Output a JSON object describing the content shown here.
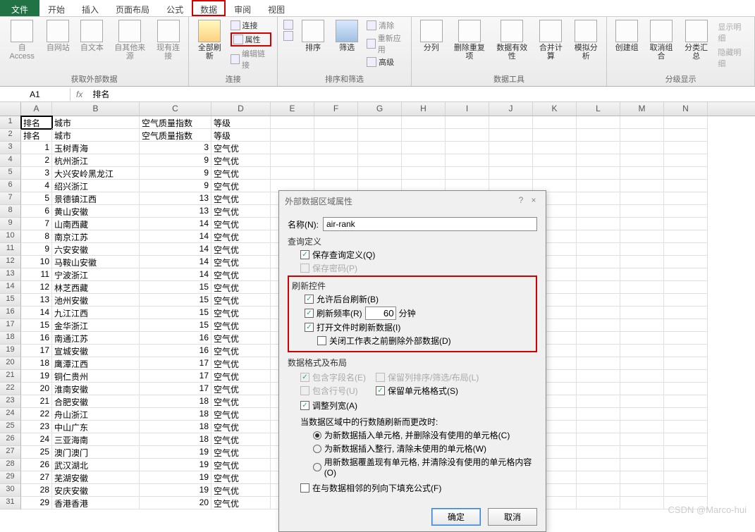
{
  "menu": {
    "file": "文件",
    "start": "开始",
    "insert": "插入",
    "pagelayout": "页面布局",
    "formula": "公式",
    "data": "数据",
    "review": "审阅",
    "view": "视图"
  },
  "ribbon": {
    "ext_data": {
      "access": "自 Access",
      "web": "自网站",
      "text": "自文本",
      "other": "自其他来源",
      "existing": "现有连接",
      "label": "获取外部数据"
    },
    "conn": {
      "refresh": "全部刷新",
      "connect": "连接",
      "props": "属性",
      "editlink": "编辑链接",
      "label": "连接"
    },
    "sort": {
      "az": "A↓Z",
      "za": "Z↓A",
      "sort": "排序",
      "filter": "筛选",
      "clear": "清除",
      "reapply": "重新应用",
      "adv": "高级",
      "label": "排序和筛选"
    },
    "tools": {
      "split": "分列",
      "dedup": "删除重复项",
      "valid": "数据有效性",
      "consol": "合并计算",
      "whatif": "模拟分析",
      "label": "数据工具"
    },
    "outline": {
      "group": "创建组",
      "ungroup": "取消组合",
      "subtotal": "分类汇总",
      "label": "分级显示",
      "show": "显示明细",
      "hide": "隐藏明细"
    }
  },
  "fx": {
    "namebox": "A1",
    "value": "排名"
  },
  "cols": [
    "A",
    "B",
    "C",
    "D",
    "E",
    "F",
    "G",
    "H",
    "I",
    "J",
    "K",
    "L",
    "M",
    "N"
  ],
  "sheet": [
    {
      "a": "排名",
      "b": "城市",
      "c": "空气质量指数",
      "d": "等级"
    },
    {
      "a": "排名",
      "b": "城市",
      "c": "空气质量指数",
      "d": "等级"
    },
    {
      "a": "1",
      "b": "玉树青海",
      "c": "3",
      "d": "空气优"
    },
    {
      "a": "2",
      "b": "杭州浙江",
      "c": "9",
      "d": "空气优"
    },
    {
      "a": "3",
      "b": "大兴安岭黑龙江",
      "c": "9",
      "d": "空气优"
    },
    {
      "a": "4",
      "b": "绍兴浙江",
      "c": "9",
      "d": "空气优"
    },
    {
      "a": "5",
      "b": "景德镇江西",
      "c": "13",
      "d": "空气优"
    },
    {
      "a": "6",
      "b": "黄山安徽",
      "c": "13",
      "d": "空气优"
    },
    {
      "a": "7",
      "b": "山南西藏",
      "c": "14",
      "d": "空气优"
    },
    {
      "a": "8",
      "b": "南京江苏",
      "c": "14",
      "d": "空气优"
    },
    {
      "a": "9",
      "b": "六安安徽",
      "c": "14",
      "d": "空气优"
    },
    {
      "a": "10",
      "b": "马鞍山安徽",
      "c": "14",
      "d": "空气优"
    },
    {
      "a": "11",
      "b": "宁波浙江",
      "c": "14",
      "d": "空气优"
    },
    {
      "a": "12",
      "b": "林芝西藏",
      "c": "15",
      "d": "空气优"
    },
    {
      "a": "13",
      "b": "池州安徽",
      "c": "15",
      "d": "空气优"
    },
    {
      "a": "14",
      "b": "九江江西",
      "c": "15",
      "d": "空气优"
    },
    {
      "a": "15",
      "b": "金华浙江",
      "c": "15",
      "d": "空气优"
    },
    {
      "a": "16",
      "b": "南通江苏",
      "c": "16",
      "d": "空气优"
    },
    {
      "a": "17",
      "b": "宣城安徽",
      "c": "16",
      "d": "空气优"
    },
    {
      "a": "18",
      "b": "鹰潭江西",
      "c": "17",
      "d": "空气优"
    },
    {
      "a": "19",
      "b": "铜仁贵州",
      "c": "17",
      "d": "空气优"
    },
    {
      "a": "20",
      "b": "淮南安徽",
      "c": "17",
      "d": "空气优"
    },
    {
      "a": "21",
      "b": "合肥安徽",
      "c": "18",
      "d": "空气优"
    },
    {
      "a": "22",
      "b": "舟山浙江",
      "c": "18",
      "d": "空气优"
    },
    {
      "a": "23",
      "b": "中山广东",
      "c": "18",
      "d": "空气优"
    },
    {
      "a": "24",
      "b": "三亚海南",
      "c": "18",
      "d": "空气优"
    },
    {
      "a": "25",
      "b": "澳门澳门",
      "c": "19",
      "d": "空气优"
    },
    {
      "a": "26",
      "b": "武汉湖北",
      "c": "19",
      "d": "空气优"
    },
    {
      "a": "27",
      "b": "芜湖安徽",
      "c": "19",
      "d": "空气优"
    },
    {
      "a": "28",
      "b": "安庆安徽",
      "c": "19",
      "d": "空气优"
    },
    {
      "a": "29",
      "b": "香港香港",
      "c": "20",
      "d": "空气优"
    }
  ],
  "dialog": {
    "title": "外部数据区域属性",
    "name_lbl": "名称(N):",
    "name_val": "air-rank",
    "query_def": "查询定义",
    "save_query": "保存查询定义(Q)",
    "save_pwd": "保存密码(P)",
    "refresh_ctrl": "刷新控件",
    "allow_bg": "允许后台刷新(B)",
    "refresh_rate": "刷新频率(R)",
    "rate_val": "60",
    "minutes": "分钟",
    "refresh_open": "打开文件时刷新数据(I)",
    "del_before_close": "关闭工作表之前删除外部数据(D)",
    "data_layout": "数据格式及布局",
    "inc_fieldname": "包含字段名(E)",
    "keep_sort": "保留列排序/筛选/布局(L)",
    "inc_rownum": "包含行号(U)",
    "keep_fmt": "保留单元格格式(S)",
    "adj_colw": "调整列宽(A)",
    "on_change": "当数据区域中的行数随刷新而更改时:",
    "opt1": "为新数据插入单元格, 并删除没有使用的单元格(C)",
    "opt2": "为新数据插入整行, 清除未使用的单元格(W)",
    "opt3": "用新数据覆盖现有单元格, 并清除没有使用的单元格内容(O)",
    "fill_formula": "在与数据相邻的列向下填充公式(F)",
    "ok": "确定",
    "cancel": "取消"
  },
  "watermark": "CSDN @Marco-hui"
}
